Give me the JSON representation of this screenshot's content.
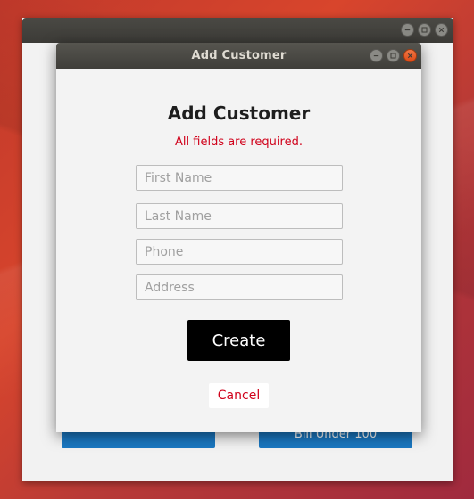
{
  "background_window": {
    "buttons": [
      {
        "label": ""
      },
      {
        "label": "Bill Under 100"
      }
    ]
  },
  "dialog": {
    "title": "Add Customer",
    "heading": "Add Customer",
    "notice": "All fields are required.",
    "fields": {
      "first_name": {
        "value": "",
        "placeholder": "First Name"
      },
      "last_name": {
        "value": "",
        "placeholder": "Last Name"
      },
      "phone": {
        "value": "",
        "placeholder": "Phone"
      },
      "address": {
        "value": "",
        "placeholder": "Address"
      }
    },
    "create_label": "Create",
    "cancel_label": "Cancel"
  },
  "colors": {
    "error_text": "#d0021b",
    "primary_button": "#000000",
    "background_button": "#1a78c2",
    "close_button": "#e95420"
  },
  "icons": {
    "window_controls": [
      "minimize-icon",
      "maximize-icon",
      "close-icon"
    ]
  }
}
